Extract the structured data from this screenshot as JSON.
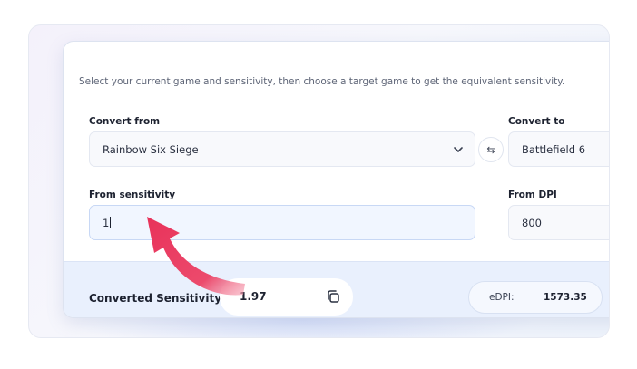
{
  "intro": "Select your current game and sensitivity, then choose a target game to get the equivalent sensitivity.",
  "convert_from": {
    "label": "Convert from",
    "value": "Rainbow Six Siege"
  },
  "convert_to": {
    "label": "Convert to",
    "value": "Battlefield 6"
  },
  "swap_symbol": "⇆",
  "from_sensitivity": {
    "label": "From sensitivity",
    "value": "1"
  },
  "from_dpi": {
    "label": "From DPI",
    "value": "800"
  },
  "result": {
    "label": "Converted Sensitivity",
    "value": "1.97"
  },
  "edpi": {
    "label": "eDPI:",
    "value": "1573.35"
  },
  "colors": {
    "arrow": "#e8325a",
    "result_bg": "#e9f0fd"
  },
  "icons": [
    "chevron-down-icon",
    "swap-icon",
    "copy-icon",
    "annotation-arrow-icon"
  ]
}
